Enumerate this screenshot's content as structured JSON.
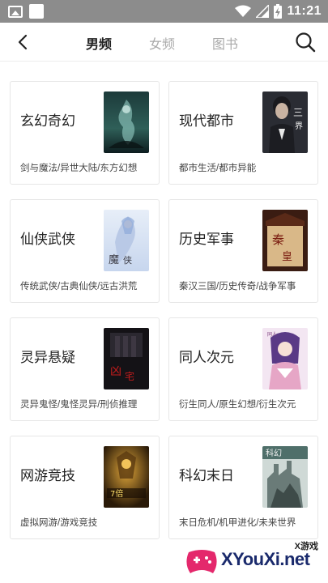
{
  "status_bar": {
    "time": "11:21"
  },
  "nav": {
    "tabs": [
      {
        "label": "男频",
        "active": true
      },
      {
        "label": "女频",
        "active": false
      },
      {
        "label": "图书",
        "active": false
      }
    ]
  },
  "categories": [
    {
      "title": "玄幻奇幻",
      "subtitle": "剑与魔法/异世大陆/东方幻想"
    },
    {
      "title": "现代都市",
      "subtitle": "都市生活/都市异能"
    },
    {
      "title": "仙侠武侠",
      "subtitle": "传统武侠/古典仙侠/远古洪荒"
    },
    {
      "title": "历史军事",
      "subtitle": "秦汉三国/历史传奇/战争军事"
    },
    {
      "title": "灵异悬疑",
      "subtitle": "灵异鬼怪/鬼怪灵异/刑侦推理"
    },
    {
      "title": "同人次元",
      "subtitle": "衍生同人/原生幻想/衍生次元"
    },
    {
      "title": "网游竞技",
      "subtitle": "虚拟网游/游戏竞技"
    },
    {
      "title": "科幻末日",
      "subtitle": "末日危机/机甲进化/未来世界"
    }
  ],
  "watermark": {
    "small": "X游戏",
    "big": "XYouXi.net"
  }
}
